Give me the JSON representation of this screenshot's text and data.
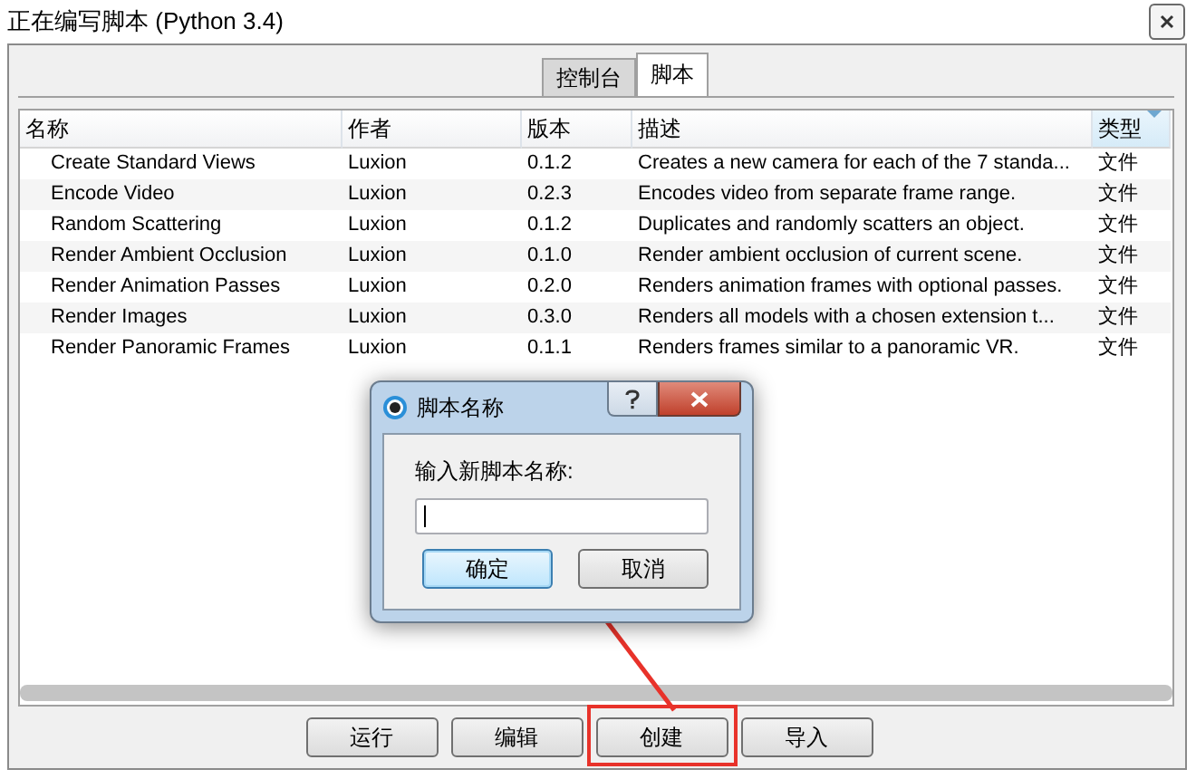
{
  "window": {
    "title": "正在编写脚本 (Python 3.4)"
  },
  "tabs": [
    {
      "label": "控制台",
      "selected": false
    },
    {
      "label": "脚本",
      "selected": true
    }
  ],
  "table": {
    "columns": [
      {
        "label": "名称",
        "sorted": false
      },
      {
        "label": "作者",
        "sorted": false
      },
      {
        "label": "版本",
        "sorted": false
      },
      {
        "label": "描述",
        "sorted": false
      },
      {
        "label": "类型",
        "sorted": true
      }
    ],
    "rows": [
      {
        "cells": [
          "Create Standard Views",
          "Luxion",
          "0.1.2",
          "Creates a new camera for each of the 7 standa...",
          "文件"
        ]
      },
      {
        "cells": [
          "Encode Video",
          "Luxion",
          "0.2.3",
          "Encodes video from separate frame range.",
          "文件"
        ]
      },
      {
        "cells": [
          "Random Scattering",
          "Luxion",
          "0.1.2",
          "Duplicates and randomly scatters an object.",
          "文件"
        ]
      },
      {
        "cells": [
          "Render Ambient Occlusion",
          "Luxion",
          "0.1.0",
          "Render ambient occlusion of current scene.",
          "文件"
        ]
      },
      {
        "cells": [
          "Render Animation Passes",
          "Luxion",
          "0.2.0",
          "Renders animation frames with optional passes.",
          "文件"
        ]
      },
      {
        "cells": [
          "Render Images",
          "Luxion",
          "0.3.0",
          "Renders all models with a chosen extension t...",
          "文件"
        ]
      },
      {
        "cells": [
          "Render Panoramic Frames",
          "Luxion",
          "0.1.1",
          "Renders frames similar to a panoramic VR.",
          "文件"
        ]
      }
    ]
  },
  "buttons": [
    {
      "label": "运行",
      "highlighted": false
    },
    {
      "label": "编辑",
      "highlighted": false
    },
    {
      "label": "创建",
      "highlighted": true
    },
    {
      "label": "导入",
      "highlighted": false
    }
  ],
  "dialog": {
    "title": "脚本名称",
    "prompt": "输入新脚本名称:",
    "buttons": [
      {
        "label": "确定",
        "default": true
      },
      {
        "label": "取消",
        "default": false
      }
    ]
  }
}
